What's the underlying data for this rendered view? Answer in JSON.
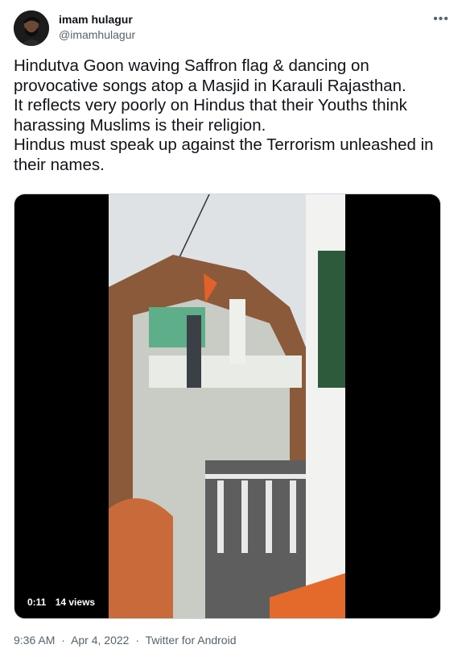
{
  "author": {
    "name": "imam hulagur",
    "handle": "@imamhulagur"
  },
  "more_icon": "ellipsis-icon",
  "tweet_text": "Hindutva Goon waving Saffron flag & dancing on provocative songs atop a Masjid in Karauli Rajasthan.\nIt reflects very poorly on Hindus that their Youths think harassing Muslims is their religion.\nHindus must speak up against the Terrorism unleashed in their names.",
  "video": {
    "duration": "0:11",
    "views": "14 views"
  },
  "meta": {
    "time": "9:36 AM",
    "separator1": "·",
    "date": "Apr 4, 2022",
    "separator2": "·",
    "source": "Twitter for Android"
  },
  "colors": {
    "text": "#0f1419",
    "secondary": "#536471",
    "border": "#cfd9de"
  }
}
